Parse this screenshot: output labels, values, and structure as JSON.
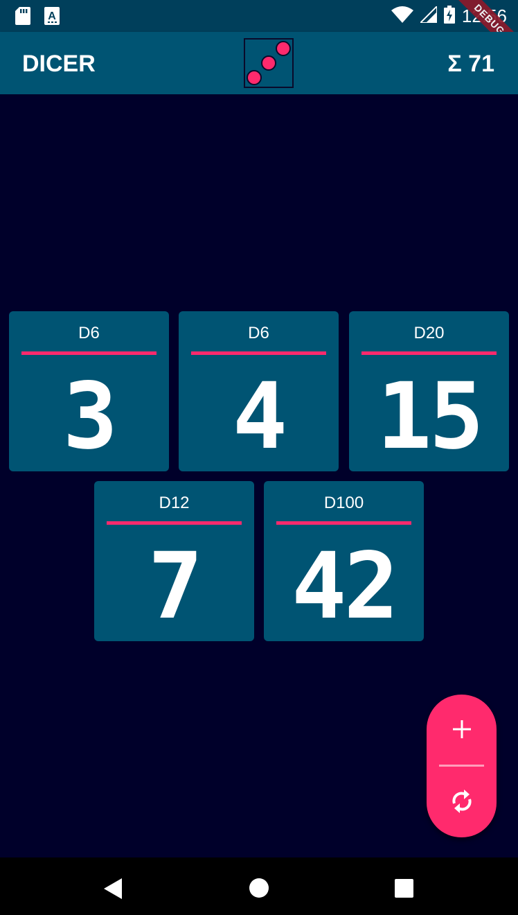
{
  "status_bar": {
    "time": "12:56",
    "left_icons": [
      "sd-card-icon",
      "keyboard-a-icon"
    ],
    "right_icons": [
      "wifi-icon",
      "signal-icon",
      "battery-charging-icon"
    ],
    "debug_label": "DEBUG"
  },
  "app_bar": {
    "title": "DICER",
    "sum_label": "Σ 71",
    "logo_icon": "three-dice-pips-icon"
  },
  "dice": [
    {
      "type": "D6",
      "value": "3"
    },
    {
      "type": "D6",
      "value": "4"
    },
    {
      "type": "D20",
      "value": "15"
    },
    {
      "type": "D12",
      "value": "7"
    },
    {
      "type": "D100",
      "value": "42"
    }
  ],
  "fab": {
    "add_icon": "plus-icon",
    "reroll_icon": "refresh-icon"
  },
  "nav_bar": {
    "icons": [
      "back-icon",
      "home-icon",
      "recents-icon"
    ]
  },
  "colors": {
    "app_bar": "#005473",
    "status_bar": "#003f5b",
    "background": "#00002a",
    "card": "#005473",
    "accent": "#ff2a6d"
  }
}
